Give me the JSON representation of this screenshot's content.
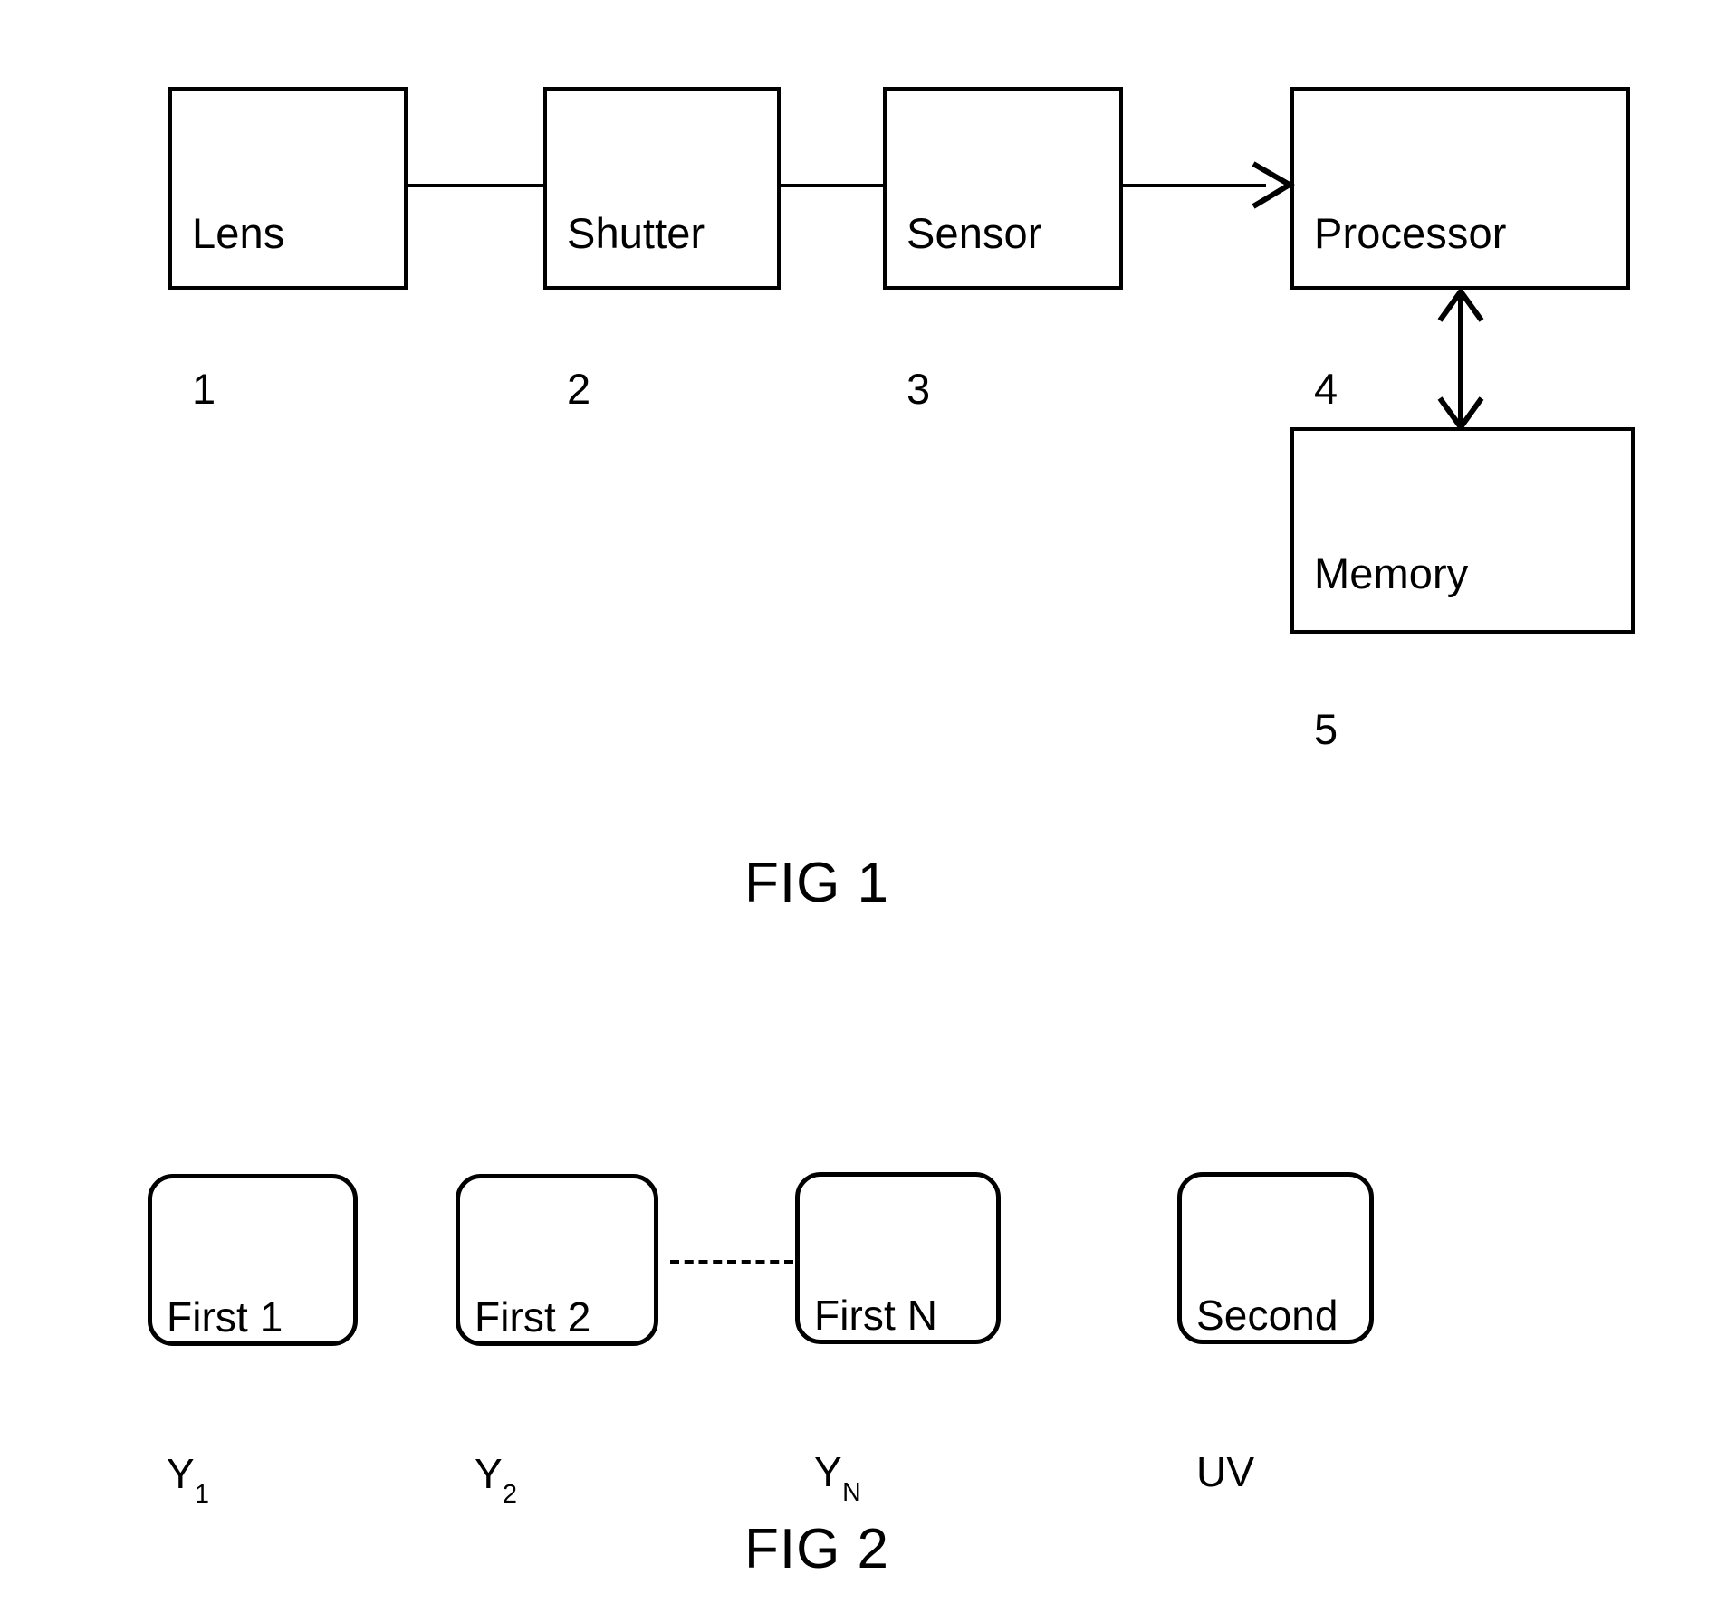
{
  "figures": [
    {
      "caption": "FIG 1",
      "blocks": [
        {
          "label": "Lens",
          "number": "1"
        },
        {
          "label": "Shutter",
          "number": "2"
        },
        {
          "label": "Sensor",
          "number": "3"
        },
        {
          "label": "Processor",
          "number": "4"
        },
        {
          "label": "Memory",
          "number": "5"
        }
      ],
      "connections": [
        {
          "from": "Lens",
          "to": "Shutter",
          "style": "plain-line",
          "direction": "none"
        },
        {
          "from": "Shutter",
          "to": "Sensor",
          "style": "plain-line",
          "direction": "none"
        },
        {
          "from": "Sensor",
          "to": "Processor",
          "style": "arrow",
          "direction": "forward"
        },
        {
          "from": "Processor",
          "to": "Memory",
          "style": "arrow",
          "direction": "bidirectional"
        }
      ]
    },
    {
      "caption": "FIG 2",
      "blocks": [
        {
          "label": "First 1",
          "symbol": "Y",
          "subscript": "1"
        },
        {
          "label": "First 2",
          "symbol": "Y",
          "subscript": "2"
        },
        {
          "label": "First N",
          "symbol": "Y",
          "subscript": "N"
        },
        {
          "label": "Second",
          "symbol": "UV",
          "subscript": ""
        }
      ],
      "connections": [
        {
          "from": "First 2",
          "to": "First N",
          "style": "dashed",
          "direction": "none"
        }
      ]
    }
  ],
  "fig1": {
    "lens": {
      "label": "Lens",
      "number": "1"
    },
    "shutter": {
      "label": "Shutter",
      "number": "2"
    },
    "sensor": {
      "label": "Sensor",
      "number": "3"
    },
    "processor": {
      "label": "Processor",
      "number": "4"
    },
    "memory": {
      "label": "Memory",
      "number": "5"
    },
    "caption": "FIG 1"
  },
  "fig2": {
    "first1": {
      "label": "First 1",
      "symbol": "Y",
      "subscript": "1"
    },
    "first2": {
      "label": "First 2",
      "symbol": "Y",
      "subscript": "2"
    },
    "firstN": {
      "label": "First N",
      "symbol": "Y",
      "subscript": "N"
    },
    "second": {
      "label": "Second",
      "symbol": "UV"
    },
    "caption": "FIG 2"
  },
  "colors": {
    "stroke": "#000000",
    "fill": "#ffffff"
  }
}
